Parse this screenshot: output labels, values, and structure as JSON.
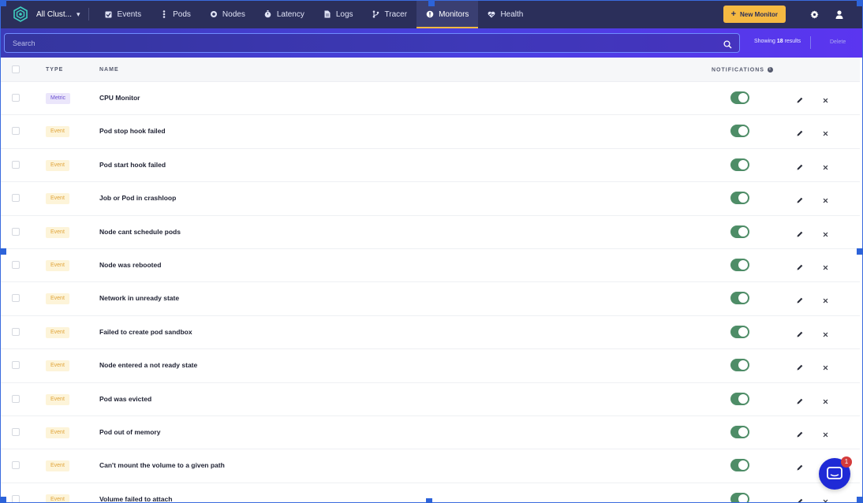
{
  "nav": {
    "cluster": "All Clust...",
    "tabs": [
      {
        "label": "Events",
        "icon": "checkbox-icon"
      },
      {
        "label": "Pods",
        "icon": "pods-icon"
      },
      {
        "label": "Nodes",
        "icon": "nodes-icon"
      },
      {
        "label": "Latency",
        "icon": "latency-icon"
      },
      {
        "label": "Logs",
        "icon": "logs-icon"
      },
      {
        "label": "Tracer",
        "icon": "tracer-icon"
      },
      {
        "label": "Monitors",
        "icon": "monitors-icon",
        "active": true
      },
      {
        "label": "Health",
        "icon": "heart-icon"
      }
    ],
    "new_monitor": "New Monitor"
  },
  "search": {
    "placeholder": "Search",
    "results_prefix": "Showing",
    "results_count": "18",
    "results_suffix": "results",
    "delete_label": "Delete"
  },
  "table": {
    "headers": {
      "type": "TYPE",
      "name": "NAME",
      "notifications": "NOTIFICATIONS"
    },
    "rows": [
      {
        "type": "Metric",
        "name": "CPU Monitor",
        "enabled": true
      },
      {
        "type": "Event",
        "name": "Pod stop hook failed",
        "enabled": true
      },
      {
        "type": "Event",
        "name": "Pod start hook failed",
        "enabled": true
      },
      {
        "type": "Event",
        "name": "Job or Pod in crashloop",
        "enabled": true
      },
      {
        "type": "Event",
        "name": "Node cant schedule pods",
        "enabled": true
      },
      {
        "type": "Event",
        "name": "Node was rebooted",
        "enabled": true
      },
      {
        "type": "Event",
        "name": "Network in unready state",
        "enabled": true
      },
      {
        "type": "Event",
        "name": "Failed to create pod sandbox",
        "enabled": true
      },
      {
        "type": "Event",
        "name": "Node entered a not ready state",
        "enabled": true
      },
      {
        "type": "Event",
        "name": "Pod was evicted",
        "enabled": true
      },
      {
        "type": "Event",
        "name": "Pod out of memory",
        "enabled": true
      },
      {
        "type": "Event",
        "name": "Can't mount the volume to a given path",
        "enabled": true
      },
      {
        "type": "Event",
        "name": "Volume failed to attach",
        "enabled": true
      }
    ]
  },
  "chat": {
    "badge": "1"
  },
  "colors": {
    "nav_bg": "#2b2f5a",
    "accent": "#f5b942",
    "toggle_on": "#4e8d67",
    "metric_badge": "#6a4fd1",
    "event_badge": "#e0a43a",
    "chat": "#1f2ad6"
  }
}
